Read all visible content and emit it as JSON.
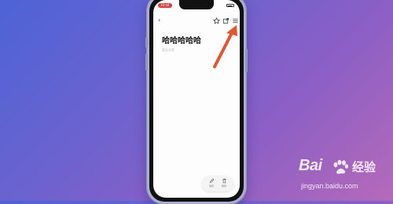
{
  "status_bar": {
    "time": "10:44"
  },
  "note": {
    "title": "哈哈哈哈哈",
    "meta": "暂无分类"
  },
  "bottom_toolbar": {
    "edit_label": "编辑",
    "delete_label": "删除"
  },
  "watermark": {
    "logo_text": "Bai",
    "logo_cn": "经验",
    "url": "jingyan.baidu.com"
  },
  "colors": {
    "arrow": "#e8542e",
    "status_badge": "#e23a3a"
  }
}
